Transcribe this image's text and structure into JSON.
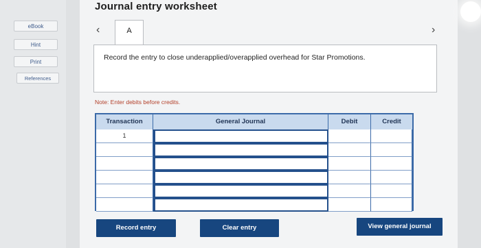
{
  "sidebar": {
    "items": [
      {
        "label": "eBook"
      },
      {
        "label": "Hint"
      },
      {
        "label": "Print"
      },
      {
        "label": "References"
      }
    ]
  },
  "worksheet": {
    "title": "Journal entry worksheet",
    "tab_label": "A",
    "prev_icon": "chevron-left-icon",
    "next_icon": "chevron-right-icon",
    "prompt": "Record the entry to close underapplied/overapplied overhead for Star Promotions.",
    "note": "Note: Enter debits before credits."
  },
  "journal": {
    "headers": {
      "transaction": "Transaction",
      "general_journal": "General Journal",
      "debit": "Debit",
      "credit": "Credit"
    },
    "rows": [
      {
        "transaction": "1",
        "general_journal": "",
        "debit": "",
        "credit": ""
      },
      {
        "transaction": "",
        "general_journal": "",
        "debit": "",
        "credit": ""
      },
      {
        "transaction": "",
        "general_journal": "",
        "debit": "",
        "credit": ""
      },
      {
        "transaction": "",
        "general_journal": "",
        "debit": "",
        "credit": ""
      },
      {
        "transaction": "",
        "general_journal": "",
        "debit": "",
        "credit": ""
      },
      {
        "transaction": "",
        "general_journal": "",
        "debit": "",
        "credit": ""
      }
    ]
  },
  "buttons": {
    "record": "Record entry",
    "clear": "Clear entry",
    "view": "View general journal"
  },
  "colors": {
    "primary_button": "#17467f",
    "table_header": "#c9daee",
    "table_border": "#3b6aa8",
    "note_text": "#b3402a"
  }
}
